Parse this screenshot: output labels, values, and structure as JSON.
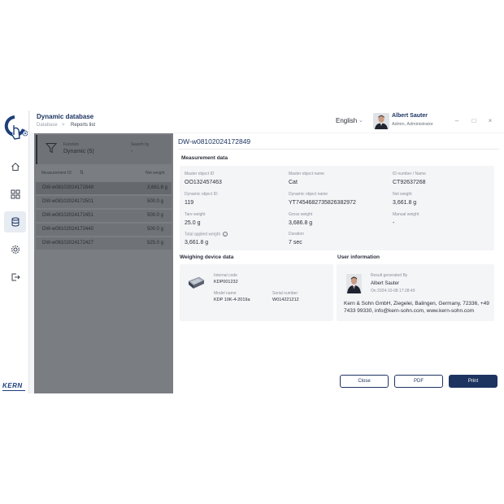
{
  "app": {
    "title": "Dynamic database",
    "breadcrumb": [
      "Database",
      ">",
      "Reports list"
    ],
    "language": "English",
    "user": {
      "name": "Albert Sauter",
      "role": "Admin, Administrator"
    },
    "brand": "KERN"
  },
  "sidebar": {
    "items": [
      {
        "icon": "home-icon",
        "active": false
      },
      {
        "icon": "grid-icon",
        "active": false
      },
      {
        "icon": "database-icon",
        "active": true
      },
      {
        "icon": "gear-icon",
        "active": false
      },
      {
        "icon": "logout-icon",
        "active": false
      }
    ]
  },
  "filter": {
    "function_label": "Function",
    "function_value": "Dynamic (5)",
    "search_label": "Search by",
    "search_value": "-"
  },
  "table": {
    "columns": [
      "Measurement ID",
      "Net weight"
    ],
    "rows": [
      {
        "id": "DW-w08102024172849",
        "weight": "3,661.8 g",
        "selected": true
      },
      {
        "id": "DW-w08102024172501",
        "weight": "500.0 g",
        "selected": false
      },
      {
        "id": "DW-w08102024172451",
        "weight": "500.0 g",
        "selected": false
      },
      {
        "id": "DW-w08102024172440",
        "weight": "500.0 g",
        "selected": false
      },
      {
        "id": "DW-w08102024172427",
        "weight": "525.0 g",
        "selected": false
      }
    ]
  },
  "detail": {
    "title": "DW-w08102024172849",
    "measurement": {
      "heading": "Measurement data",
      "fields": [
        {
          "label": "Master object ID",
          "value": "OO132457463"
        },
        {
          "label": "Master object name",
          "value": "Cat"
        },
        {
          "label": "ID number / Name",
          "value": "CT92637268"
        },
        {
          "label": "Dynamic object ID",
          "value": "119"
        },
        {
          "label": "Dynamic object name",
          "value": "YT7454682735826382972"
        },
        {
          "label": "Net weight",
          "value": "3,661.8 g"
        },
        {
          "label": "Tare weight",
          "value": "25.0 g"
        },
        {
          "label": "Gross weight",
          "value": "3,686.8 g"
        },
        {
          "label": "Manual weight",
          "value": "-"
        },
        {
          "label": "Total applied weight",
          "value": "3,661.8 g"
        },
        {
          "label": "Duration",
          "value": "7 sec"
        }
      ]
    },
    "device": {
      "heading": "Weighing device data",
      "internal_code_label": "Internal code",
      "internal_code": "KDP001232",
      "model_label": "Model name",
      "model": "KDP 10K-4-2019a",
      "serial_label": "Serial number",
      "serial": "W014221212"
    },
    "user_info": {
      "heading": "User information",
      "generated_label": "Result generated By",
      "generated_by": "Albert Sauter",
      "date": "On 2024-10-08 17:28:49",
      "address": "Kern & Sohn GmbH, Ziegelei, Balingen, Germany, 72336, +49 7433 99330, info@kern-sohn.com, www.kern-sohn.com"
    },
    "buttons": {
      "close": "Close",
      "pdf": "PDF",
      "print": "Print"
    }
  },
  "colors": {
    "accent": "#1d3461",
    "overlay": "#7a7d82",
    "card": "#f4f5f7"
  }
}
